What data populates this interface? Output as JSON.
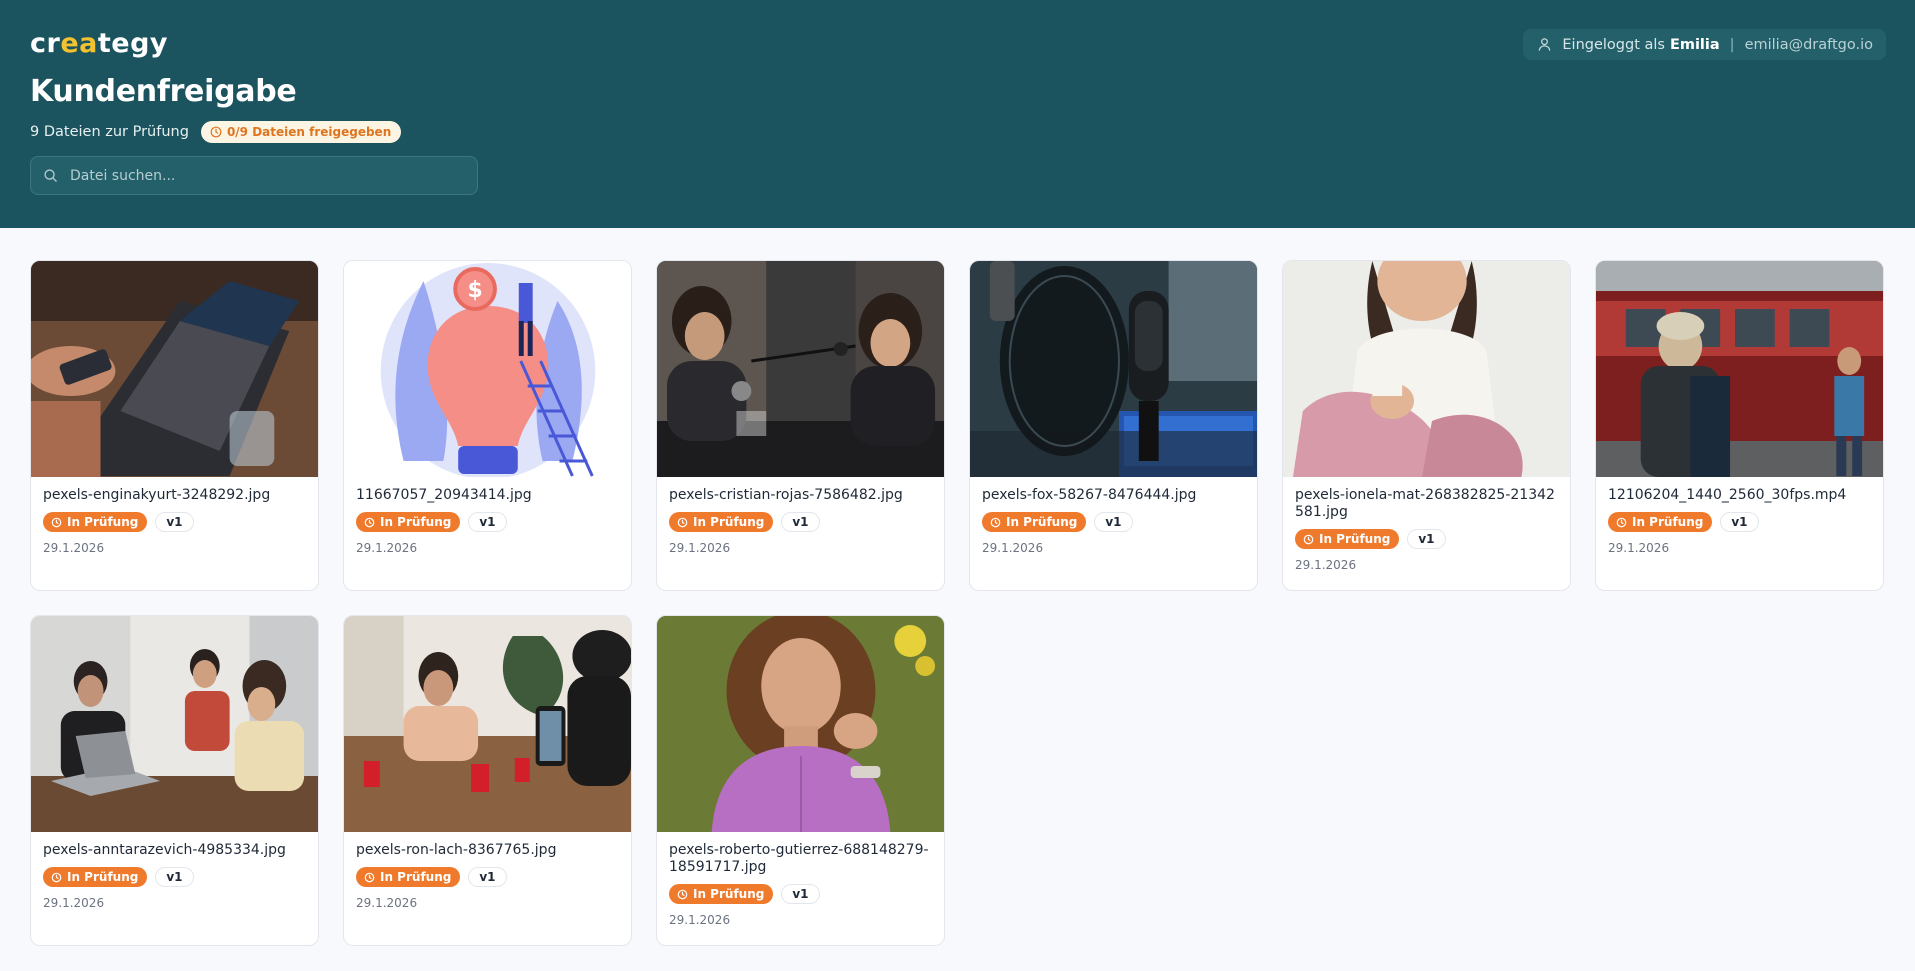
{
  "brand": {
    "logo_pre": "cr",
    "logo_accent": "ea",
    "logo_post": "tegy"
  },
  "user": {
    "logged_in_prefix": "Eingeloggt als",
    "name": "Emilia",
    "separator": "|",
    "email": "emilia@draftgo.io"
  },
  "page": {
    "title": "Kundenfreigabe",
    "file_count_text": "9 Dateien zur Prüfung",
    "approved_badge": "0/9 Dateien freigegeben"
  },
  "search": {
    "placeholder": "Datei suchen..."
  },
  "colors": {
    "header_bg": "#1b545e",
    "accent": "#f07a2c",
    "logo_accent": "#f2c230"
  },
  "files": [
    {
      "name": "pexels-enginakyurt-3248292.jpg",
      "status": "In Prüfung",
      "version": "v1",
      "date": "29.1.2026",
      "thumb": "laptop-phone-photo"
    },
    {
      "name": "11667057_20943414.jpg",
      "status": "In Prüfung",
      "version": "v1",
      "date": "29.1.2026",
      "thumb": "lightbulb-illustration"
    },
    {
      "name": "pexels-cristian-rojas-7586482.jpg",
      "status": "In Prüfung",
      "version": "v1",
      "date": "29.1.2026",
      "thumb": "podcast-women-photo"
    },
    {
      "name": "pexels-fox-58267-8476444.jpg",
      "status": "In Prüfung",
      "version": "v1",
      "date": "29.1.2026",
      "thumb": "microphone-photo"
    },
    {
      "name": "pexels-ionela-mat-268382825-21342581.jpg",
      "status": "In Prüfung",
      "version": "v1",
      "date": "29.1.2026",
      "thumb": "sitting-woman-photo"
    },
    {
      "name": "12106204_1440_2560_30fps.mp4",
      "status": "In Prüfung",
      "version": "v1",
      "date": "29.1.2026",
      "thumb": "tram-street-video"
    },
    {
      "name": "pexels-anntarazevich-4985334.jpg",
      "status": "In Prüfung",
      "version": "v1",
      "date": "29.1.2026",
      "thumb": "office-team-photo"
    },
    {
      "name": "pexels-ron-lach-8367765.jpg",
      "status": "In Prüfung",
      "version": "v1",
      "date": "29.1.2026",
      "thumb": "cups-game-photo"
    },
    {
      "name": "pexels-roberto-gutierrez-688148279-18591717.jpg",
      "status": "In Prüfung",
      "version": "v1",
      "date": "29.1.2026",
      "thumb": "curly-hair-portrait-photo"
    }
  ]
}
